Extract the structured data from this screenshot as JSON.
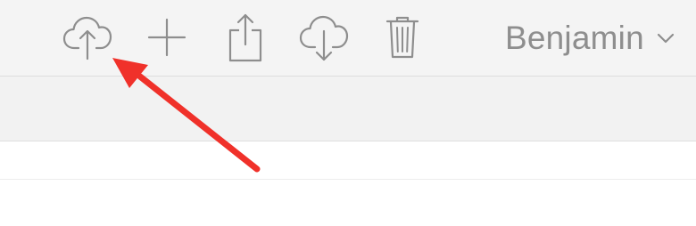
{
  "toolbar": {
    "buttons": [
      {
        "name": "upload",
        "icon": "cloud-upload-icon"
      },
      {
        "name": "new",
        "icon": "plus-icon"
      },
      {
        "name": "share",
        "icon": "share-icon"
      },
      {
        "name": "download",
        "icon": "cloud-download-icon"
      },
      {
        "name": "delete",
        "icon": "trash-icon"
      }
    ],
    "account_name": "Benjamin",
    "account_menu_icon": "chevron-down-icon"
  },
  "colors": {
    "icon": "#8e8e8e",
    "toolbar_bg": "#f4f4f4",
    "subbar_bg": "#f2f2f2",
    "annotation_arrow": "#f0312a"
  },
  "annotation": {
    "icon": "red-arrow-icon",
    "points_to": "upload"
  }
}
